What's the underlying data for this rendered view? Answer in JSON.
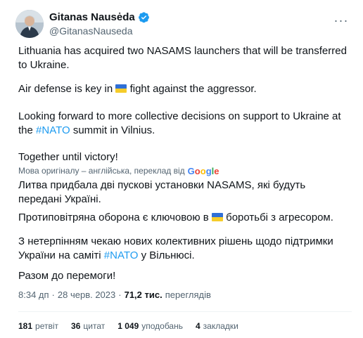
{
  "author": {
    "display_name": "Gitanas Nausėda",
    "handle": "@GitanasNauseda",
    "verified": true,
    "avatar_icon": "user-avatar"
  },
  "tweet": {
    "p1": "Lithuania has acquired two NASAMS launchers that will be transferred to Ukraine.",
    "p2_before": "Air defense is key in ",
    "p2_after": " fight against the aggressor.",
    "p3_before": "Looking forward to more collective decisions on support to Ukraine at the ",
    "p3_hashtag": "#NATO",
    "p3_after": " summit in Vilnius.",
    "p4": "Together until victory!"
  },
  "translation": {
    "note": "Мова оригіналу – англійська, переклад від",
    "provider": "Google",
    "t1": "Литва придбала дві пускові установки NASAMS, які будуть передані Україні.",
    "t2_before": "Протиповітряна оборона є ключовою в ",
    "t2_after": " боротьбі з агресором.",
    "t3_before": "З нетерпінням чекаю нових колективних рішень щодо підтримки України на саміті ",
    "t3_hashtag": "#NATO",
    "t3_after": " у Вільнюсі.",
    "t4": "Разом до перемоги!"
  },
  "meta": {
    "time": "8:34 дп",
    "separator": "·",
    "date": "28 черв. 2023",
    "views_count": "71,2 тис.",
    "views_label": "переглядів"
  },
  "stats": [
    {
      "count": "181",
      "label": "ретвіт"
    },
    {
      "count": "36",
      "label": "цитат"
    },
    {
      "count": "1 049",
      "label": "уподобань"
    },
    {
      "count": "4",
      "label": "закладки"
    }
  ],
  "colors": {
    "link": "#1d9bf0",
    "secondary_text": "#536471",
    "verified": "#1d9bf0",
    "flag_blue": "#2f6fd6",
    "flag_yellow": "#f5cc2a"
  }
}
